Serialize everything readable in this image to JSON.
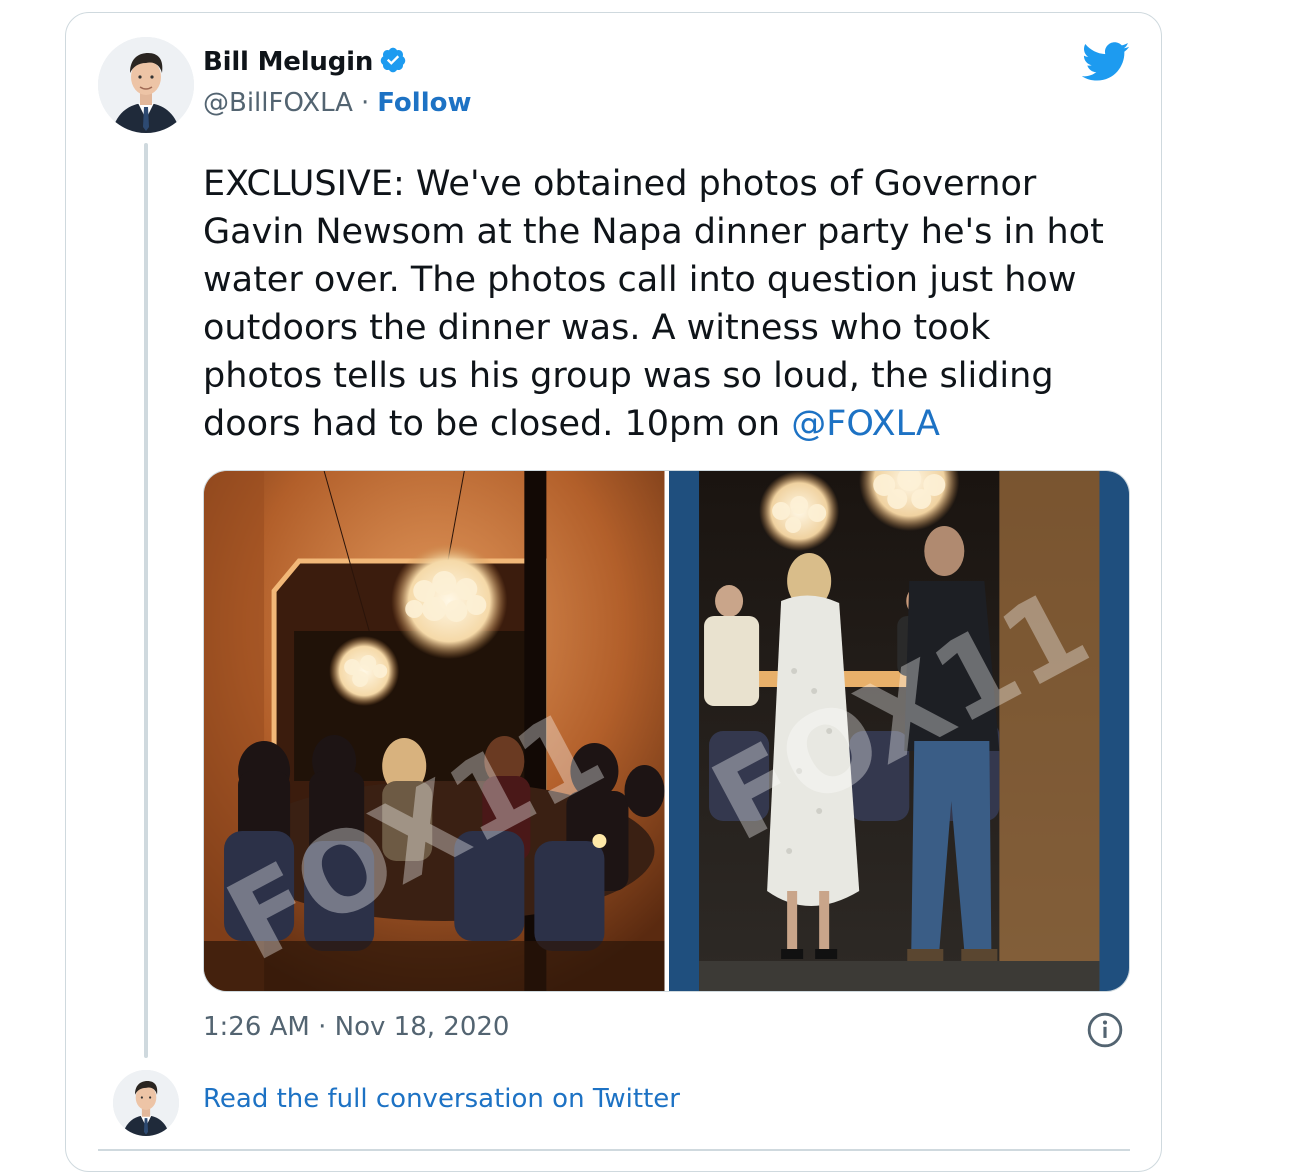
{
  "tweet": {
    "author": {
      "name": "Bill Melugin",
      "handle": "@BillFOXLA",
      "separator": "·",
      "follow_label": "Follow",
      "verified": true
    },
    "text_before_mention": "EXCLUSIVE: We've obtained photos of Governor\nGavin Newsom at the Napa dinner party he's in hot\nwater over. The photos call into question just how\noutdoors the dinner was. A witness who took\nphotos tells us his group was so loud, the sliding\ndoors had to be closed. 10pm on ",
    "mention": "@FOXLA",
    "media": [
      {
        "watermark": "FOX11"
      },
      {
        "watermark": "FOX11"
      }
    ],
    "timestamp": "1:26 AM · Nov 18, 2020",
    "read_full_label": "Read the full conversation on Twitter"
  },
  "colors": {
    "link": "#1d72c4",
    "verified_badge": "#1d9bf0",
    "twitter_blue": "#1d9bf0",
    "secondary_text": "#536471",
    "border": "#cfd9de"
  },
  "icons": {
    "brand": "twitter-bird-icon",
    "verified": "verified-badge-icon",
    "info": "info-icon"
  }
}
